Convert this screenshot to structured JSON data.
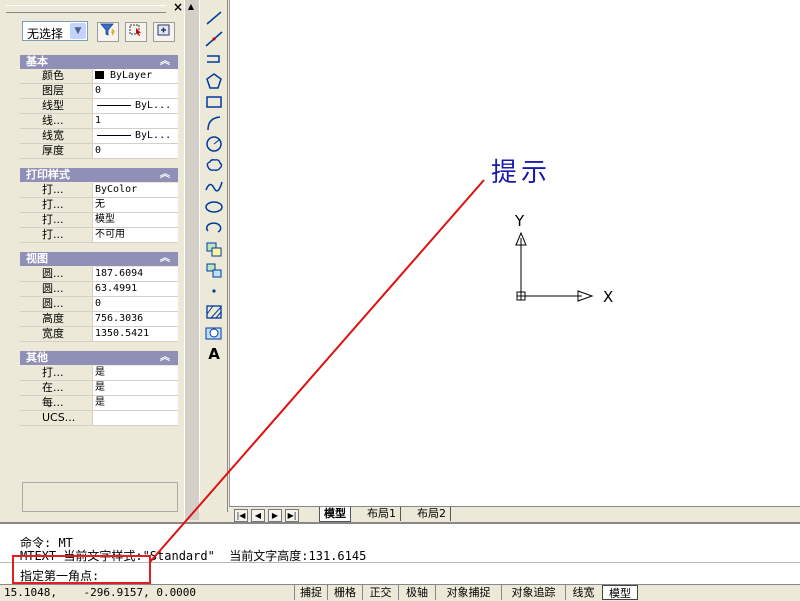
{
  "palette": {
    "close_label": "×",
    "selection": "无选择",
    "sections": {
      "basic": {
        "title": "基本",
        "rows": [
          {
            "name": "颜色",
            "value": "ByLayer"
          },
          {
            "name": "图层",
            "value": "0"
          },
          {
            "name": "线型",
            "value": "ByL..."
          },
          {
            "name": "线...",
            "value": "1"
          },
          {
            "name": "线宽",
            "value": "ByL..."
          },
          {
            "name": "厚度",
            "value": "0"
          }
        ]
      },
      "plot": {
        "title": "打印样式",
        "rows": [
          {
            "name": "打...",
            "value": "ByColor"
          },
          {
            "name": "打...",
            "value": "无"
          },
          {
            "name": "打...",
            "value": "模型"
          },
          {
            "name": "打...",
            "value": "不可用"
          }
        ]
      },
      "view": {
        "title": "视图",
        "rows": [
          {
            "name": "圆...",
            "value": "187.6094"
          },
          {
            "name": "圆...",
            "value": "63.4991"
          },
          {
            "name": "圆...",
            "value": "0"
          },
          {
            "name": "高度",
            "value": "756.3036"
          },
          {
            "name": "宽度",
            "value": "1350.5421"
          }
        ]
      },
      "misc": {
        "title": "其他",
        "rows": [
          {
            "name": "打...",
            "value": "是"
          },
          {
            "name": "在...",
            "value": "是"
          },
          {
            "name": "每...",
            "value": "是"
          },
          {
            "name": "UCS...",
            "value": ""
          }
        ]
      }
    }
  },
  "draw_toolbar": {
    "tools": [
      "line-icon",
      "construction-line-icon",
      "polyline-icon",
      "polygon-icon",
      "rectangle-icon",
      "arc-icon",
      "circle-icon",
      "revision-cloud-icon",
      "spline-icon",
      "ellipse-icon",
      "ellipse-arc-icon",
      "insert-block-icon",
      "make-block-icon",
      "point-icon",
      "hatch-icon",
      "region-icon",
      "multiline-text-icon"
    ],
    "text_tool_label": "A"
  },
  "canvas": {
    "annotation": "提示",
    "ucs_x": "X",
    "ucs_y": "Y",
    "annotation_color": "#e01010",
    "annotation_text_color": "#1a1ab0"
  },
  "layout_tabs": {
    "nav": [
      "|◀",
      "◀",
      "▶",
      "▶|"
    ],
    "tabs": [
      "模型",
      "布局1",
      "布局2"
    ]
  },
  "command": {
    "line1": "命令: MT",
    "line2": "MTEXT 当前文字样式:\"Standard\"  当前文字高度:131.6145",
    "line3": "指定第一角点:"
  },
  "status": {
    "coords": "15.1048,    -296.9157, 0.0000",
    "buttons": [
      "捕捉",
      "栅格",
      "正交",
      "极轴",
      "对象捕捉",
      "对象追踪",
      "线宽",
      "模型"
    ]
  }
}
